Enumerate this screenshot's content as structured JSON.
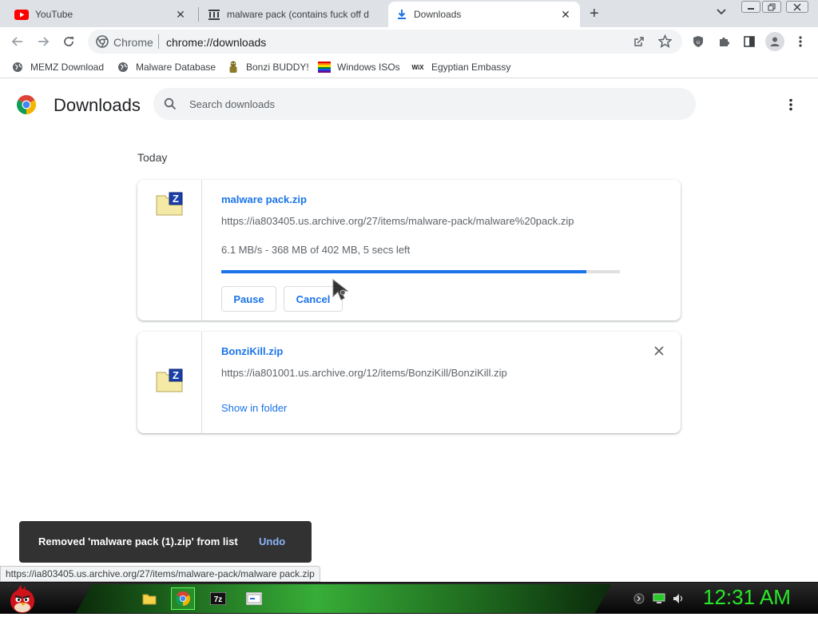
{
  "tabs": [
    {
      "title": "YouTube",
      "icon": "youtube-icon"
    },
    {
      "title": "malware pack (contains fuck off d",
      "icon": "archive-icon"
    },
    {
      "title": "Downloads",
      "icon": "download-icon",
      "active": true
    }
  ],
  "new_tab_label": "+",
  "toolbar": {
    "omnibox_site": "Chrome",
    "omnibox_url": "chrome://downloads"
  },
  "bookmarks": [
    {
      "label": "MEMZ Download"
    },
    {
      "label": "Malware Database"
    },
    {
      "label": "Bonzi BUDDY!"
    },
    {
      "label": "Windows ISOs"
    },
    {
      "label": "Egyptian Embassy"
    }
  ],
  "page": {
    "title": "Downloads",
    "search_placeholder": "Search downloads",
    "section_date": "Today"
  },
  "downloads": [
    {
      "filename": "malware pack.zip",
      "url": "https://ia803405.us.archive.org/27/items/malware-pack/malware%20pack.zip",
      "status": "6.1 MB/s - 368 MB of 402 MB, 5 secs left",
      "progress": 0.915,
      "pause_label": "Pause",
      "cancel_label": "Cancel"
    },
    {
      "filename": "BonziKill.zip",
      "url": "https://ia801001.us.archive.org/12/items/BonziKill/BonziKill.zip",
      "show_in_folder_label": "Show in folder"
    }
  ],
  "toast": {
    "message": "Removed 'malware pack (1).zip' from list",
    "undo_label": "Undo"
  },
  "status_bubble": "https://ia803405.us.archive.org/27/items/malware-pack/malware pack.zip",
  "taskbar": {
    "clock": "12:31 AM"
  },
  "colors": {
    "accent": "#1a73e8",
    "clock": "#29e829"
  }
}
